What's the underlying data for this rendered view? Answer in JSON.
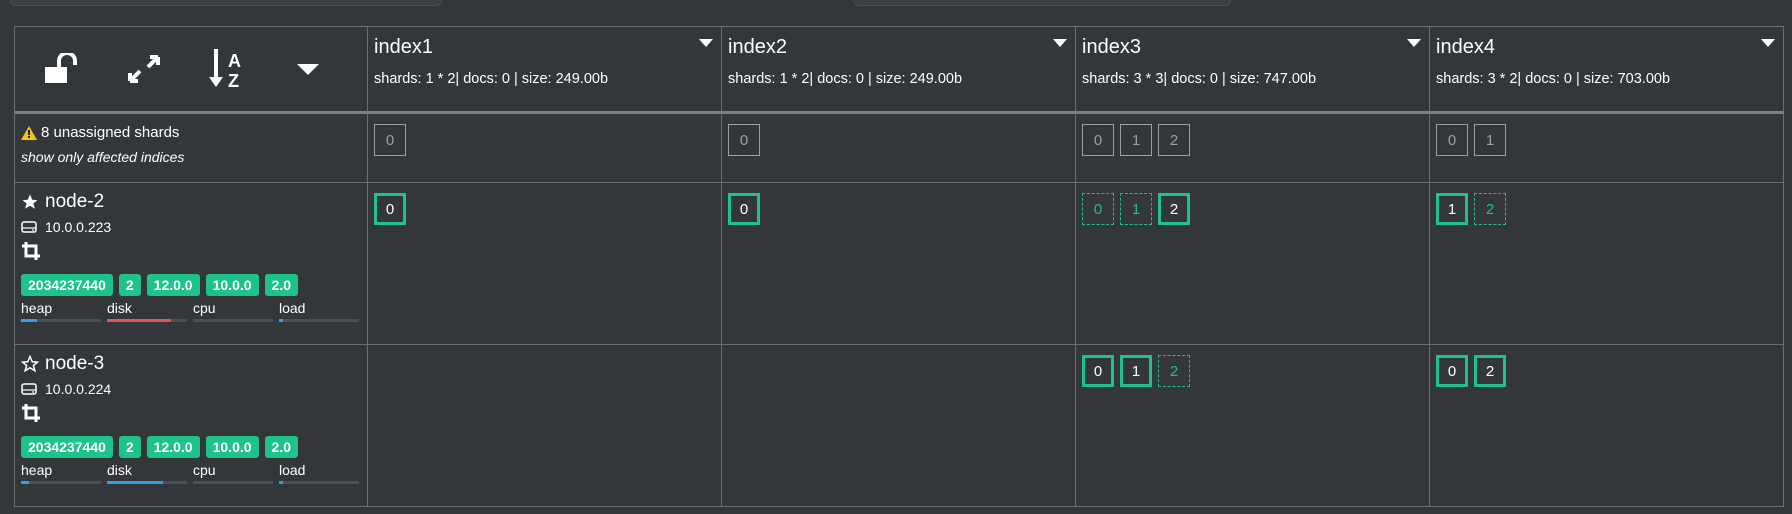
{
  "colors": {
    "accent": "#1ec28b",
    "disk_warn": "#e0545c",
    "bar_blue": "#2f9fe6",
    "background": "#33373a"
  },
  "toolbar": {
    "lock_icon": "unlock-icon",
    "expand_icon": "expand-arrows-icon",
    "sort_icon": "sort-az-icon",
    "menu_icon": "caret-down-icon"
  },
  "indices": [
    {
      "name": "index1",
      "stats": "shards: 1 * 2| docs: 0 | size: 249.00b"
    },
    {
      "name": "index2",
      "stats": "shards: 1 * 2| docs: 0 | size: 249.00b"
    },
    {
      "name": "index3",
      "stats": "shards: 3 * 3| docs: 0 | size: 747.00b"
    },
    {
      "name": "index4",
      "stats": "shards: 3 * 2| docs: 0 | size: 703.00b"
    }
  ],
  "unassigned": {
    "label": "8 unassigned shards",
    "filter_label": "show only affected indices",
    "shards": [
      [
        "0"
      ],
      [
        "0"
      ],
      [
        "0",
        "1",
        "2"
      ],
      [
        "0",
        "1"
      ]
    ]
  },
  "nodes": [
    {
      "name": "node-2",
      "ip": "10.0.0.223",
      "master_icon": "star-filled-icon",
      "badges": [
        "2034237440",
        "2",
        "12.0.0",
        "10.0.0",
        "2.0"
      ],
      "metrics": {
        "heap": "heap",
        "disk": "disk",
        "cpu": "cpu",
        "load": "load"
      },
      "levels": {
        "heap": 0.2,
        "disk": 0.8,
        "cpu": 0.0,
        "load": 0.05
      },
      "shards": [
        [
          {
            "n": "0",
            "t": "primary"
          }
        ],
        [
          {
            "n": "0",
            "t": "primary"
          }
        ],
        [
          {
            "n": "0",
            "t": "replica"
          },
          {
            "n": "1",
            "t": "replica"
          },
          {
            "n": "2",
            "t": "primary"
          }
        ],
        [
          {
            "n": "1",
            "t": "primary"
          },
          {
            "n": "2",
            "t": "replica"
          }
        ]
      ]
    },
    {
      "name": "node-3",
      "ip": "10.0.0.224",
      "master_icon": "star-outline-icon",
      "badges": [
        "2034237440",
        "2",
        "12.0.0",
        "10.0.0",
        "2.0"
      ],
      "metrics": {
        "heap": "heap",
        "disk": "disk",
        "cpu": "cpu",
        "load": "load"
      },
      "levels": {
        "heap": 0.1,
        "disk": 0.7,
        "cpu": 0.0,
        "load": 0.05
      },
      "shards": [
        [],
        [],
        [
          {
            "n": "0",
            "t": "primary"
          },
          {
            "n": "1",
            "t": "primary"
          },
          {
            "n": "2",
            "t": "replica"
          }
        ],
        [
          {
            "n": "0",
            "t": "primary"
          },
          {
            "n": "2",
            "t": "primary"
          }
        ]
      ]
    }
  ]
}
